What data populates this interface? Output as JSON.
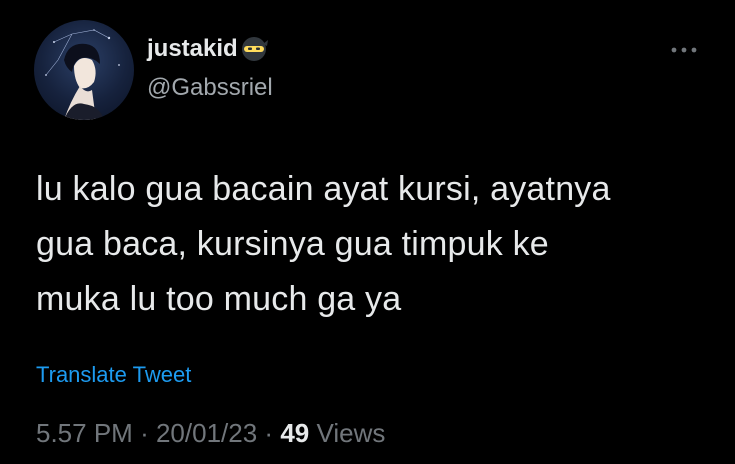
{
  "user": {
    "display_name": "justakid",
    "name_emoji": "ninja-emoji-icon",
    "handle": "@Gabssriel",
    "avatar": "avatar"
  },
  "menu": {
    "icon": "more-dots-icon"
  },
  "tweet": {
    "text": "lu kalo gua bacain ayat kursi, ayatnya\ngua baca, kursinya gua timpuk ke\nmuka lu too much ga ya",
    "translate_label": "Translate Tweet"
  },
  "meta": {
    "time": "5.57 PM",
    "separator": "·",
    "date": "20/01/23",
    "views_count": "49",
    "views_label": "Views"
  },
  "colors": {
    "background": "#000000",
    "text": "#e7e9ea",
    "secondary": "#71767b",
    "link": "#1d9bf0"
  }
}
